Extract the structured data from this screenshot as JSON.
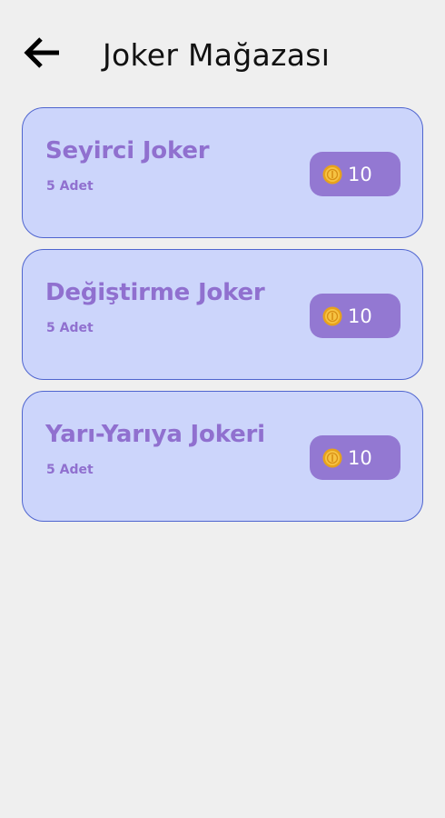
{
  "header": {
    "back_icon": "arrow-left-icon",
    "title": "Joker Mağazası"
  },
  "items": [
    {
      "name": "Seyirci Joker",
      "quantity": "5 Adet",
      "price": "10",
      "price_icon": "coin-icon"
    },
    {
      "name": "Değiştirme Joker",
      "quantity": "5 Adet",
      "price": "10",
      "price_icon": "coin-icon"
    },
    {
      "name": "Yarı-Yarıya Jokeri",
      "quantity": "5 Adet",
      "price": "10",
      "price_icon": "coin-icon"
    }
  ],
  "colors": {
    "background": "#efefef",
    "card_bg": "#ccd5fb",
    "card_border": "#4f65cf",
    "accent_text": "#9070cf",
    "price_button": "#9378d2",
    "coin": "#f3b526"
  }
}
